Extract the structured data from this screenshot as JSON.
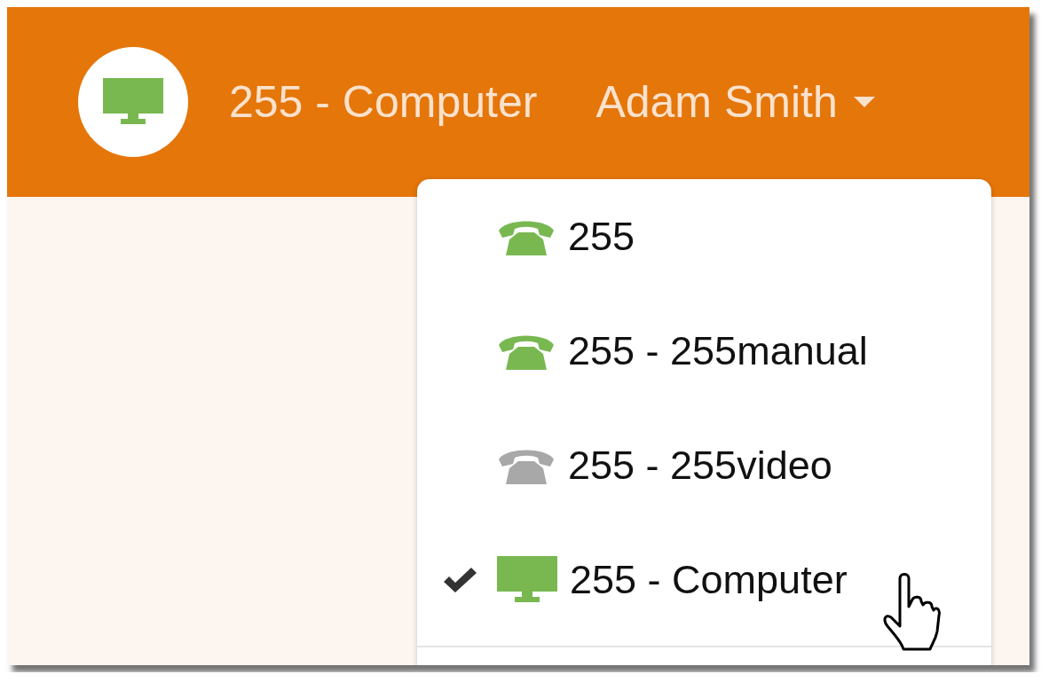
{
  "header": {
    "device": {
      "kind": "monitor",
      "label": "255 - Computer"
    },
    "user_menu": {
      "label": "Adam Smith",
      "expanded": true
    }
  },
  "dropdown": {
    "items": [
      {
        "kind": "phone",
        "label": "255",
        "available": true,
        "checked": false
      },
      {
        "kind": "phone",
        "label": "255 - 255manual",
        "available": true,
        "checked": false
      },
      {
        "kind": "phone",
        "label": "255 - 255video",
        "available": false,
        "checked": false
      },
      {
        "kind": "monitor",
        "label": "255 - Computer",
        "available": true,
        "checked": true
      }
    ]
  }
}
